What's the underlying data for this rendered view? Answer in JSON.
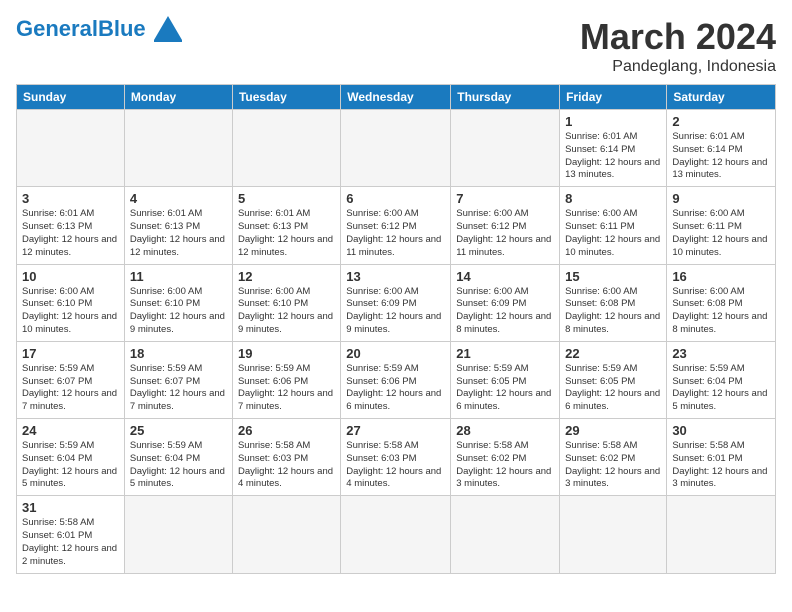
{
  "header": {
    "logo_general": "General",
    "logo_blue": "Blue",
    "title": "March 2024",
    "subtitle": "Pandeglang, Indonesia"
  },
  "days_of_week": [
    "Sunday",
    "Monday",
    "Tuesday",
    "Wednesday",
    "Thursday",
    "Friday",
    "Saturday"
  ],
  "weeks": [
    [
      {
        "day": null,
        "info": null
      },
      {
        "day": null,
        "info": null
      },
      {
        "day": null,
        "info": null
      },
      {
        "day": null,
        "info": null
      },
      {
        "day": null,
        "info": null
      },
      {
        "day": "1",
        "info": "Sunrise: 6:01 AM\nSunset: 6:14 PM\nDaylight: 12 hours\nand 13 minutes."
      },
      {
        "day": "2",
        "info": "Sunrise: 6:01 AM\nSunset: 6:14 PM\nDaylight: 12 hours\nand 13 minutes."
      }
    ],
    [
      {
        "day": "3",
        "info": "Sunrise: 6:01 AM\nSunset: 6:13 PM\nDaylight: 12 hours\nand 12 minutes."
      },
      {
        "day": "4",
        "info": "Sunrise: 6:01 AM\nSunset: 6:13 PM\nDaylight: 12 hours\nand 12 minutes."
      },
      {
        "day": "5",
        "info": "Sunrise: 6:01 AM\nSunset: 6:13 PM\nDaylight: 12 hours\nand 12 minutes."
      },
      {
        "day": "6",
        "info": "Sunrise: 6:00 AM\nSunset: 6:12 PM\nDaylight: 12 hours\nand 11 minutes."
      },
      {
        "day": "7",
        "info": "Sunrise: 6:00 AM\nSunset: 6:12 PM\nDaylight: 12 hours\nand 11 minutes."
      },
      {
        "day": "8",
        "info": "Sunrise: 6:00 AM\nSunset: 6:11 PM\nDaylight: 12 hours\nand 10 minutes."
      },
      {
        "day": "9",
        "info": "Sunrise: 6:00 AM\nSunset: 6:11 PM\nDaylight: 12 hours\nand 10 minutes."
      }
    ],
    [
      {
        "day": "10",
        "info": "Sunrise: 6:00 AM\nSunset: 6:10 PM\nDaylight: 12 hours\nand 10 minutes."
      },
      {
        "day": "11",
        "info": "Sunrise: 6:00 AM\nSunset: 6:10 PM\nDaylight: 12 hours\nand 9 minutes."
      },
      {
        "day": "12",
        "info": "Sunrise: 6:00 AM\nSunset: 6:10 PM\nDaylight: 12 hours\nand 9 minutes."
      },
      {
        "day": "13",
        "info": "Sunrise: 6:00 AM\nSunset: 6:09 PM\nDaylight: 12 hours\nand 9 minutes."
      },
      {
        "day": "14",
        "info": "Sunrise: 6:00 AM\nSunset: 6:09 PM\nDaylight: 12 hours\nand 8 minutes."
      },
      {
        "day": "15",
        "info": "Sunrise: 6:00 AM\nSunset: 6:08 PM\nDaylight: 12 hours\nand 8 minutes."
      },
      {
        "day": "16",
        "info": "Sunrise: 6:00 AM\nSunset: 6:08 PM\nDaylight: 12 hours\nand 8 minutes."
      }
    ],
    [
      {
        "day": "17",
        "info": "Sunrise: 5:59 AM\nSunset: 6:07 PM\nDaylight: 12 hours\nand 7 minutes."
      },
      {
        "day": "18",
        "info": "Sunrise: 5:59 AM\nSunset: 6:07 PM\nDaylight: 12 hours\nand 7 minutes."
      },
      {
        "day": "19",
        "info": "Sunrise: 5:59 AM\nSunset: 6:06 PM\nDaylight: 12 hours\nand 7 minutes."
      },
      {
        "day": "20",
        "info": "Sunrise: 5:59 AM\nSunset: 6:06 PM\nDaylight: 12 hours\nand 6 minutes."
      },
      {
        "day": "21",
        "info": "Sunrise: 5:59 AM\nSunset: 6:05 PM\nDaylight: 12 hours\nand 6 minutes."
      },
      {
        "day": "22",
        "info": "Sunrise: 5:59 AM\nSunset: 6:05 PM\nDaylight: 12 hours\nand 6 minutes."
      },
      {
        "day": "23",
        "info": "Sunrise: 5:59 AM\nSunset: 6:04 PM\nDaylight: 12 hours\nand 5 minutes."
      }
    ],
    [
      {
        "day": "24",
        "info": "Sunrise: 5:59 AM\nSunset: 6:04 PM\nDaylight: 12 hours\nand 5 minutes."
      },
      {
        "day": "25",
        "info": "Sunrise: 5:59 AM\nSunset: 6:04 PM\nDaylight: 12 hours\nand 5 minutes."
      },
      {
        "day": "26",
        "info": "Sunrise: 5:58 AM\nSunset: 6:03 PM\nDaylight: 12 hours\nand 4 minutes."
      },
      {
        "day": "27",
        "info": "Sunrise: 5:58 AM\nSunset: 6:03 PM\nDaylight: 12 hours\nand 4 minutes."
      },
      {
        "day": "28",
        "info": "Sunrise: 5:58 AM\nSunset: 6:02 PM\nDaylight: 12 hours\nand 3 minutes."
      },
      {
        "day": "29",
        "info": "Sunrise: 5:58 AM\nSunset: 6:02 PM\nDaylight: 12 hours\nand 3 minutes."
      },
      {
        "day": "30",
        "info": "Sunrise: 5:58 AM\nSunset: 6:01 PM\nDaylight: 12 hours\nand 3 minutes."
      }
    ],
    [
      {
        "day": "31",
        "info": "Sunrise: 5:58 AM\nSunset: 6:01 PM\nDaylight: 12 hours\nand 2 minutes."
      },
      {
        "day": null,
        "info": null
      },
      {
        "day": null,
        "info": null
      },
      {
        "day": null,
        "info": null
      },
      {
        "day": null,
        "info": null
      },
      {
        "day": null,
        "info": null
      },
      {
        "day": null,
        "info": null
      }
    ]
  ]
}
